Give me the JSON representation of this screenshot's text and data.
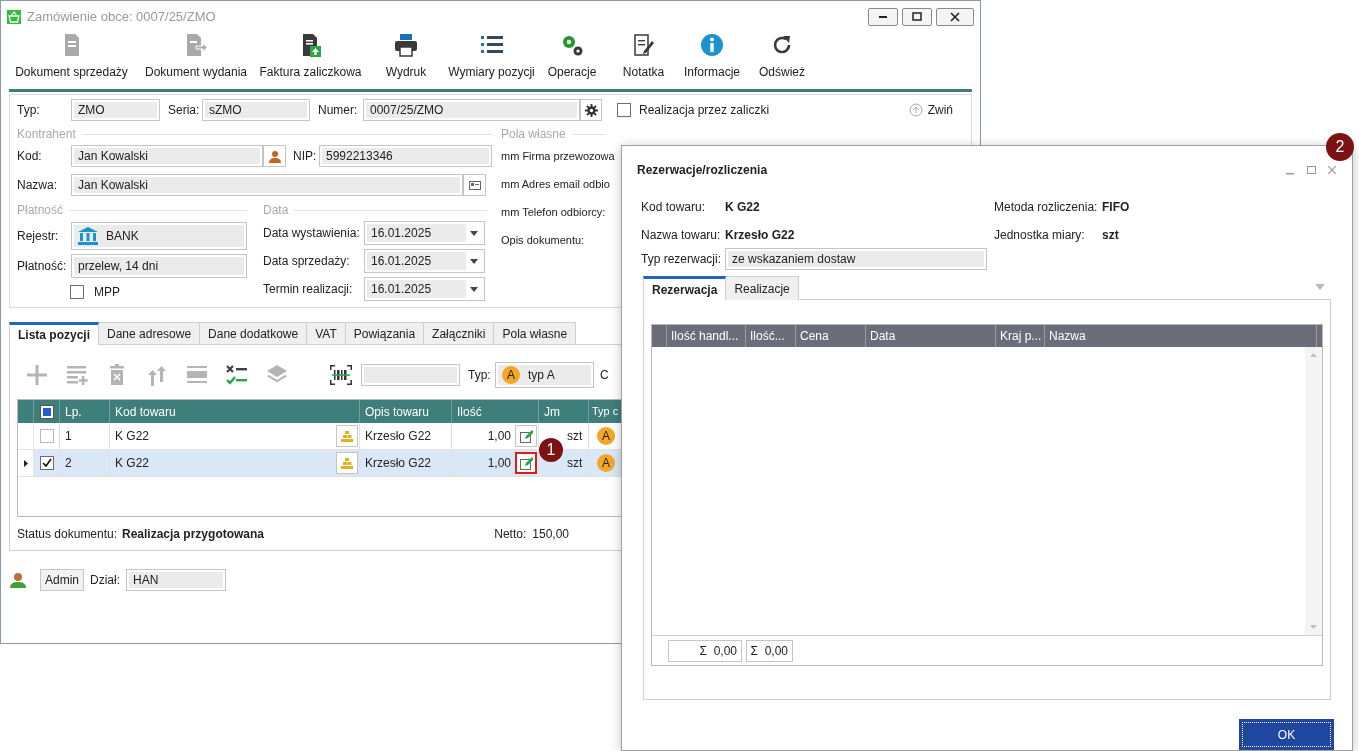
{
  "window": {
    "title": "Zamówienie obce: 0007/25/ZMO"
  },
  "toolbar": [
    {
      "label": "Dokument sprzedaży",
      "kind": "doc",
      "disabled": true
    },
    {
      "label": "Dokument wydania",
      "kind": "doc-arrow",
      "disabled": true
    },
    {
      "label": "Faktura zaliczkowa",
      "kind": "invoice",
      "disabled": false
    },
    {
      "label": "Wydruk",
      "kind": "print",
      "disabled": false
    },
    {
      "label": "Wymiary pozycji",
      "kind": "list",
      "disabled": false
    },
    {
      "label": "Operacje",
      "kind": "gears",
      "disabled": false
    },
    {
      "label": "Notatka",
      "kind": "note",
      "disabled": false
    },
    {
      "label": "Informacje",
      "kind": "info",
      "disabled": false
    },
    {
      "label": "Odśwież",
      "kind": "refresh",
      "disabled": false
    }
  ],
  "header": {
    "typ_label": "Typ:",
    "typ": "ZMO",
    "seria_label": "Seria:",
    "seria": "sZMO",
    "numer_label": "Numer:",
    "numer": "0007/25/ZMO",
    "zaliczki": {
      "label": "Realizacja przez zaliczki",
      "checked": false
    },
    "collapse": "Zwiń"
  },
  "kontrahent": {
    "title": "Kontrahent",
    "kod_label": "Kod:",
    "kod": "Jan Kowalski",
    "nip_label": "NIP:",
    "nip": "5992213346",
    "nazwa_label": "Nazwa:",
    "nazwa": "Jan Kowalski"
  },
  "platnosc": {
    "title": "Płatność",
    "rejestr_label": "Rejestr:",
    "rejestr": "BANK",
    "platnosc_label": "Płatność:",
    "platnosc": "przelew, 14 dni",
    "mpp": {
      "label": "MPP",
      "checked": false
    }
  },
  "data": {
    "title": "Data",
    "fields": [
      {
        "label": "Data wystawienia:",
        "value": "16.01.2025"
      },
      {
        "label": "Data sprzedaży:",
        "value": "16.01.2025"
      },
      {
        "label": "Termin realizacji:",
        "value": "16.01.2025"
      }
    ]
  },
  "pola_wlasne": {
    "title": "Pola własne",
    "fields": [
      "mm Firma przewozowa",
      "mm Adres email odbio",
      "mm Telefon odbiorcy:",
      "Opis dokumentu:"
    ]
  },
  "tabs": [
    {
      "label": "Lista pozycji",
      "selected": true
    },
    {
      "label": "Dane adresowe",
      "selected": false
    },
    {
      "label": "Dane dodatkowe",
      "selected": false
    },
    {
      "label": "VAT",
      "selected": false
    },
    {
      "label": "Powiązania",
      "selected": false
    },
    {
      "label": "Załączniki",
      "selected": false
    },
    {
      "label": "Pola własne",
      "selected": false
    }
  ],
  "positions_toolbar": {
    "tools": [
      {
        "kind": "plus",
        "disabled": true
      },
      {
        "kind": "add-lines",
        "disabled": true
      },
      {
        "kind": "trash",
        "disabled": true
      },
      {
        "kind": "sort",
        "disabled": true
      },
      {
        "kind": "bar",
        "disabled": true
      },
      {
        "kind": "checklist",
        "disabled": false
      },
      {
        "kind": "layers",
        "disabled": true
      }
    ],
    "typ_label": "Typ:",
    "typ_badge": "A",
    "typ": "typ A",
    "cut_label": "C"
  },
  "table": {
    "select_all": {
      "indeterminate": true
    },
    "columns": [
      "Lp.",
      "Kod towaru",
      "Opis towaru",
      "Ilość",
      "Jm",
      "Typ c"
    ],
    "rows": [
      {
        "lp": "1",
        "kod": "K G22",
        "opis": "Krzesło G22",
        "ilosc": "1,00",
        "jm": "szt",
        "typ": "A",
        "checked": false,
        "selected": false,
        "highlighted": false
      },
      {
        "lp": "2",
        "kod": "K G22",
        "opis": "Krzesło G22",
        "ilosc": "1,00",
        "jm": "szt",
        "typ": "A",
        "checked": true,
        "selected": true,
        "highlighted": true
      }
    ]
  },
  "status": {
    "label": "Status dokumentu:",
    "value": "Realizacja przygotowana",
    "netto_label": "Netto:",
    "netto": "150,00"
  },
  "footer": {
    "user": "Admin",
    "dzial_label": "Dział:",
    "dzial": "HAN"
  },
  "dialog": {
    "title": "Rezerwacje/rozliczenia",
    "kod_label": "Kod towaru:",
    "kod": "K G22",
    "metoda_label": "Metoda rozliczenia:",
    "metoda": "FIFO",
    "nazwa_label": "Nazwa towaru:",
    "nazwa": "Krzesło G22",
    "jm_label": "Jednostka miary:",
    "jm": "szt",
    "typ_label": "Typ rezerwacji:",
    "typ": "ze wskazaniem dostaw",
    "tabs": [
      {
        "label": "Rezerwacja",
        "selected": true
      },
      {
        "label": "Realizacje",
        "selected": false
      }
    ],
    "columns": [
      "Ilość handl...",
      "Ilość...",
      "Cena",
      "Data",
      "Kraj p...",
      "Nazwa"
    ],
    "sums": [
      "Σ  0,00",
      "Σ  0,00"
    ],
    "ok": "OK"
  },
  "annotations": [
    {
      "label": "1"
    },
    {
      "label": "2"
    }
  ]
}
